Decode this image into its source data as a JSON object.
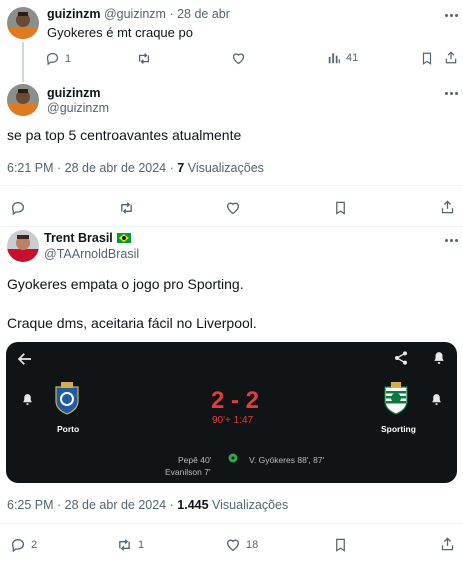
{
  "reply1": {
    "name": "guizinzm",
    "handle": "@guizinzm",
    "date": "· 28 de abr",
    "text": "Gyokeres é mt craque po",
    "replies": "1",
    "views": "41"
  },
  "main_tweet": {
    "name": "guizinzm",
    "handle": "@guizinzm",
    "text": "se pa top 5 centroavantes atualmente",
    "time": "6:21 PM · 28 de abr de 2024 ·",
    "views_count": "7",
    "views_label": "Visualizações"
  },
  "quote_tweet": {
    "name": "Trent Brasil",
    "flag": "🇧🇷",
    "handle": "@TAArnoldBrasil",
    "line1": "Gyokeres empata o jogo pro Sporting.",
    "line2": "Craque dms, aceitaria fácil no Liverpool.",
    "time": "6:25 PM · 28 de abr de 2024 ·",
    "views_count": "1.445",
    "views_label": "Visualizações",
    "replies": "2",
    "retweets": "1",
    "likes": "18"
  },
  "match_card": {
    "home_team": "Porto",
    "away_team": "Sporting",
    "score": "2 - 2",
    "minute": "90'+ 1:47",
    "home_scorers_1": "Pepê 40'",
    "home_scorers_2": "Evanilson 7'",
    "away_scorers": "V. Gyökeres 88', 87'"
  },
  "colors": {
    "muted": "#536471",
    "score_red": "#e53b3b",
    "card_bg": "#111416",
    "divider": "#eff3f4"
  },
  "icons": [
    "reply-icon",
    "retweet-icon",
    "like-icon",
    "views-icon",
    "bookmark-icon",
    "share-icon",
    "more-icon",
    "back-arrow-icon",
    "bell-icon",
    "ball-icon"
  ]
}
